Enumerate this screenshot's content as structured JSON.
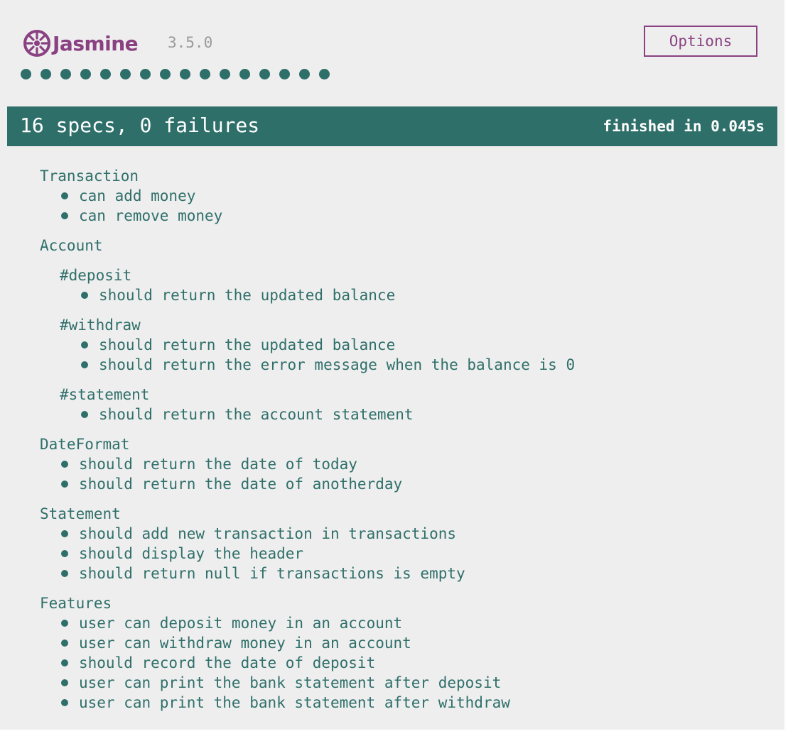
{
  "header": {
    "logo_text": "Jasmine",
    "version": "3.5.0",
    "options_label": "Options",
    "brand_color": "#8a4182",
    "pass_color": "#2f6f6a",
    "passed_dot_count": 16
  },
  "summary": {
    "text": "16 specs, 0 failures",
    "duration": "finished in 0.045s"
  },
  "suites": [
    {
      "title": "Transaction",
      "specs": [
        "can add money",
        "can remove money"
      ]
    },
    {
      "title": "Account",
      "suites": [
        {
          "title": "#deposit",
          "specs": [
            "should return the updated balance"
          ]
        },
        {
          "title": "#withdraw",
          "specs": [
            "should return the updated balance",
            "should return the error message when the balance is 0"
          ]
        },
        {
          "title": "#statement",
          "specs": [
            "should return the account statement"
          ]
        }
      ]
    },
    {
      "title": "DateFormat",
      "specs": [
        "should return the date of today",
        "should return the date of anotherday"
      ]
    },
    {
      "title": "Statement",
      "specs": [
        "should add new transaction in transactions",
        "should display the header",
        "should return null if transactions is empty"
      ]
    },
    {
      "title": "Features",
      "specs": [
        "user can deposit money in an account",
        "user can withdraw money in an account",
        "should record the date of deposit",
        "user can print the bank statement after deposit",
        "user can print the bank statement after withdraw"
      ]
    }
  ]
}
